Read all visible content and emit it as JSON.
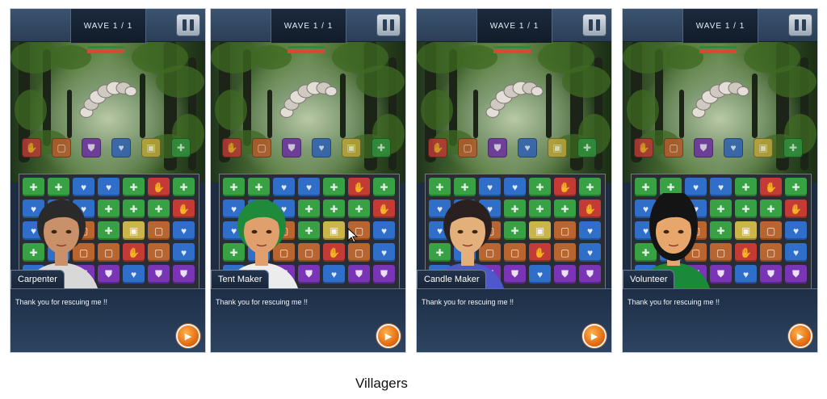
{
  "caption": "Villagers",
  "screens": [
    {
      "wave_label": "WAVE 1 / 1",
      "character_name": "Carpenter",
      "dialog": "Thank you for rescuing me !!",
      "hair": "#2a2a2a",
      "skin": "#c9916a",
      "shirt": "#d8d8d8"
    },
    {
      "wave_label": "WAVE 1 / 1",
      "character_name": "Tent Maker",
      "dialog": "Thank you for rescuing me !!",
      "hair": "#1f8a3a",
      "skin": "#e0a06e",
      "shirt": "#ececec"
    },
    {
      "wave_label": "WAVE 1 / 1",
      "character_name": "Candle Maker",
      "dialog": "Thank you for rescuing me !!",
      "hair": "#2b2020",
      "skin": "#e3b07c",
      "shirt": "#4e58c9"
    },
    {
      "wave_label": "WAVE 1 / 1",
      "character_name": "Volunteer",
      "dialog": "Thank you for rescuing me !!",
      "hair": "#141414",
      "skin": "#e7a66c",
      "shirt": "#1a8a3a"
    }
  ],
  "icons": {
    "pause": "pause-icon",
    "next": "next-arrow-icon",
    "cursor": "mouse-cursor-icon"
  },
  "slot_colors": [
    "#b93a36",
    "#b45a2a",
    "#6a2fa0",
    "#2f5fb0",
    "#b9a33a",
    "#2f8f3e"
  ],
  "tile_colors": {
    "green": "#37a144",
    "blue": "#2f6ec9",
    "red": "#c33b34",
    "brown": "#b8652f",
    "purple": "#7a34b6",
    "yellow": "#c9b54a"
  }
}
